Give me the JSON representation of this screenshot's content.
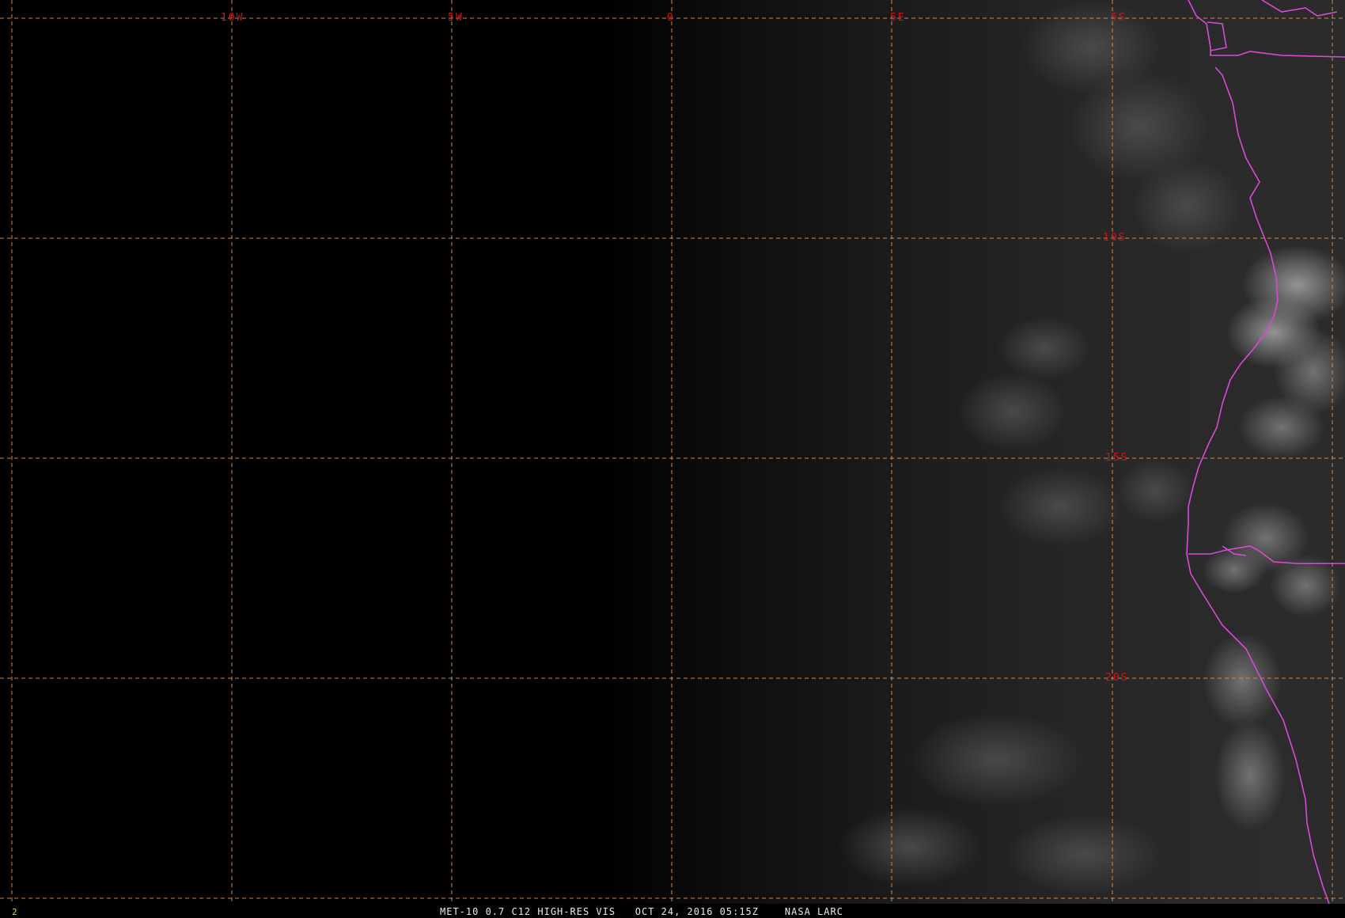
{
  "map": {
    "longitude_labels": [
      "10W",
      "5W",
      "0",
      "5E"
    ],
    "latitude_labels": [
      "5S",
      "10S",
      "15S",
      "20S"
    ],
    "grid_color": "#d2894a",
    "label_color": "#c81818",
    "boundary_color": "#d84ad8",
    "layers": [
      "visible-imagery",
      "lat-lon-grid",
      "coastline",
      "political-boundaries"
    ]
  },
  "footer": {
    "frame_number": "2",
    "caption": "MET-10 0.7 C12 HIGH-RES VIS   OCT 24, 2016 05:15Z    NASA LARC"
  }
}
